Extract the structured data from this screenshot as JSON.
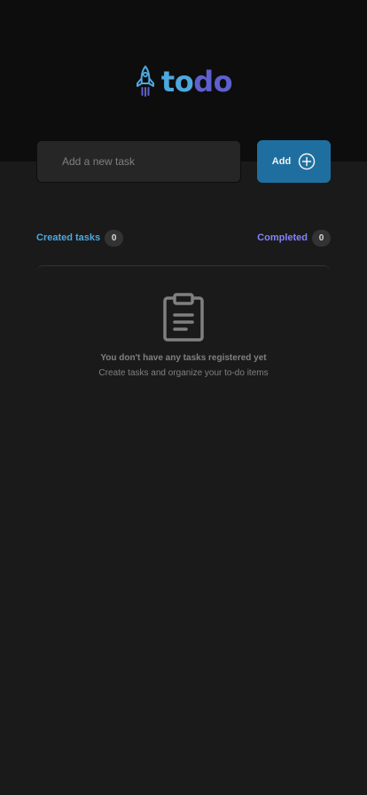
{
  "header": {
    "logo_icon": "rocket-icon",
    "logo_part1": "to",
    "logo_part2": "do"
  },
  "form": {
    "placeholder": "Add a new task",
    "value": "",
    "add_label": "Add",
    "add_icon": "plus-circle-icon"
  },
  "counters": {
    "created_label": "Created tasks",
    "created_count": "0",
    "completed_label": "Completed",
    "completed_count": "0"
  },
  "empty_state": {
    "icon": "clipboard-icon",
    "title": "You don't have any tasks registered yet",
    "subtitle": "Create tasks and organize your to-do items"
  },
  "colors": {
    "background": "#1a1a1a",
    "header": "#0d0d0d",
    "blue": "#4ea8de",
    "blue_dark": "#1e6f9f",
    "purple": "#5e60ce",
    "purple_light": "#8284fa"
  }
}
